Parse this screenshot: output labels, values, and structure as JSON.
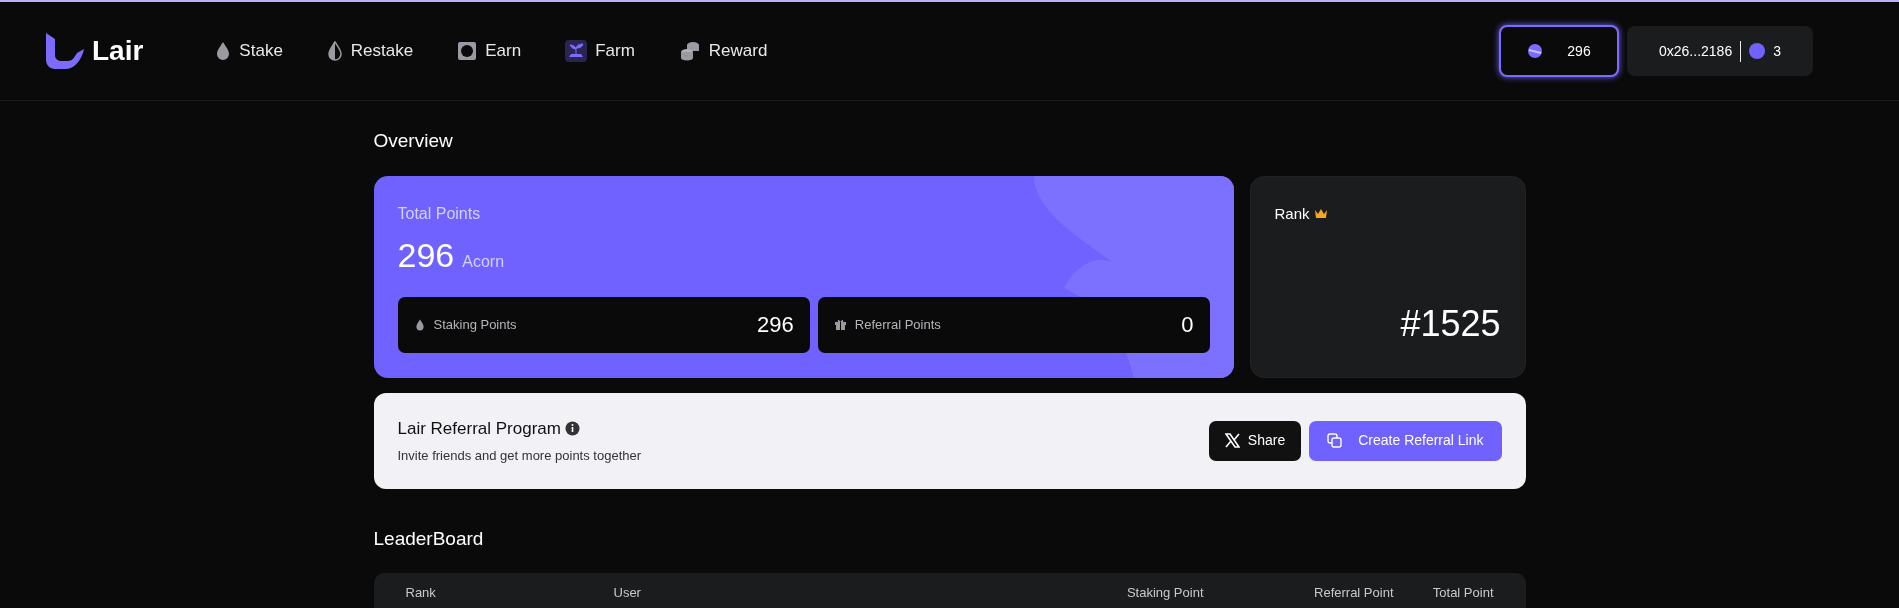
{
  "brand": "Lair",
  "nav": [
    {
      "label": "Stake",
      "kind": "drop"
    },
    {
      "label": "Restake",
      "kind": "halfdrop"
    },
    {
      "label": "Earn",
      "kind": "dollar"
    },
    {
      "label": "Farm",
      "kind": "sprout"
    },
    {
      "label": "Reward",
      "kind": "coins"
    }
  ],
  "points_button": {
    "value": "296"
  },
  "wallet": {
    "address": "0x26...2186",
    "badge": "3"
  },
  "overview": {
    "title": "Overview",
    "total_label": "Total Points",
    "total_value": "296",
    "unit": "Acorn",
    "breakdown": [
      {
        "label": "Staking Points",
        "value": "296",
        "kind": "drop"
      },
      {
        "label": "Referral Points",
        "value": "0",
        "kind": "gift"
      }
    ],
    "rank_label": "Rank",
    "rank_value": "#1525"
  },
  "referral": {
    "title": "Lair Referral Program",
    "subtitle": "Invite friends and get more points together",
    "share": "Share",
    "create": "Create Referral Link"
  },
  "leaderboard": {
    "title": "LeaderBoard",
    "columns": [
      "Rank",
      "User",
      "Staking Point",
      "Referral Point",
      "Total Point"
    ]
  }
}
